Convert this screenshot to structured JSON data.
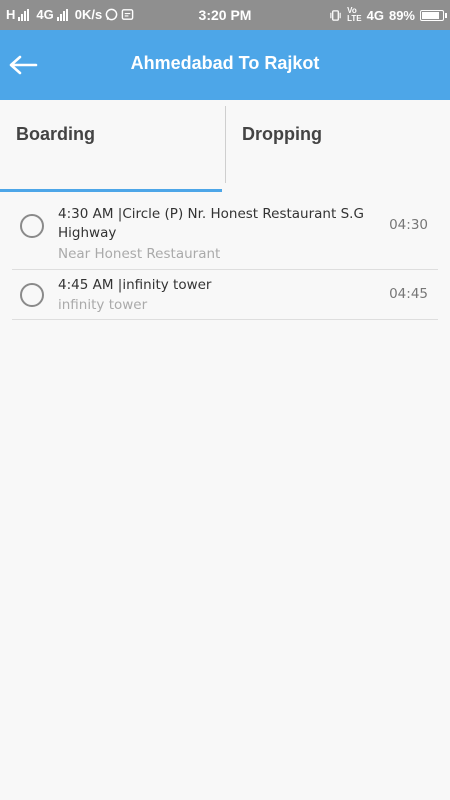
{
  "status_bar": {
    "left_text_1": "H",
    "left_text_2": "4G",
    "speed": "0K/s",
    "time": "3:20 PM",
    "network": "4G",
    "battery": "89%",
    "battery_level": 0.89
  },
  "header": {
    "title": "Ahmedabad To Rajkot",
    "background": "#4da6e8"
  },
  "tabs": [
    {
      "label": "Boarding",
      "active": true
    },
    {
      "label": "Dropping",
      "active": false
    }
  ],
  "stops": [
    {
      "title": "4:30 AM |Circle (P) Nr. Honest Restaurant S.G Highway",
      "subtitle": "Near Honest Restaurant",
      "time": "04:30"
    },
    {
      "title": "4:45 AM |infinity tower",
      "subtitle": "infinity tower",
      "time": "04:45"
    }
  ]
}
